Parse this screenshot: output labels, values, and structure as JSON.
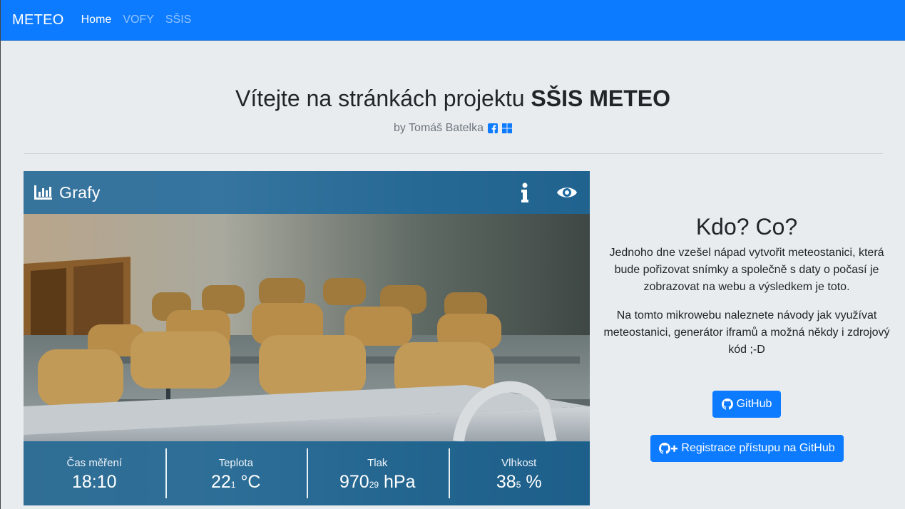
{
  "nav": {
    "brand": "METEO",
    "items": [
      {
        "label": "Home",
        "active": true
      },
      {
        "label": "VOFY",
        "active": false
      },
      {
        "label": "SŠIS",
        "active": false
      }
    ]
  },
  "header": {
    "title_prefix": "Vítejte na stránkách projektu",
    "title_bold": "SŠIS METEO",
    "byline": "by Tomáš Batelka"
  },
  "card": {
    "title": "Grafy",
    "stats": [
      {
        "label": "Čas měření",
        "value": "18:10",
        "decimal": "",
        "unit": ""
      },
      {
        "label": "Teplota",
        "value": "22",
        "decimal": "1",
        "unit": "°C"
      },
      {
        "label": "Tlak",
        "value": "970",
        "decimal": "29",
        "unit": "hPa"
      },
      {
        "label": "Vlhkost",
        "value": "38",
        "decimal": "5",
        "unit": "%"
      }
    ]
  },
  "about": {
    "heading": "Kdo? Co?",
    "para1": "Jednoho dne vzešel nápad vytvořit meteostanici, která bude pořizovat snímky a společně s daty o počasí je zobrazovat na webu a výsledkem je toto.",
    "para2": "Na tomto mikrowebu naleznete návody jak využívat meteostanici, generátor iframů a možná někdy i zdrojový kód ;-D",
    "github_button": "GitHub",
    "register_button": "Registrace přístupu na GitHub"
  },
  "colors": {
    "primary": "#0d7bff",
    "card_overlay": "#1b69a0"
  }
}
